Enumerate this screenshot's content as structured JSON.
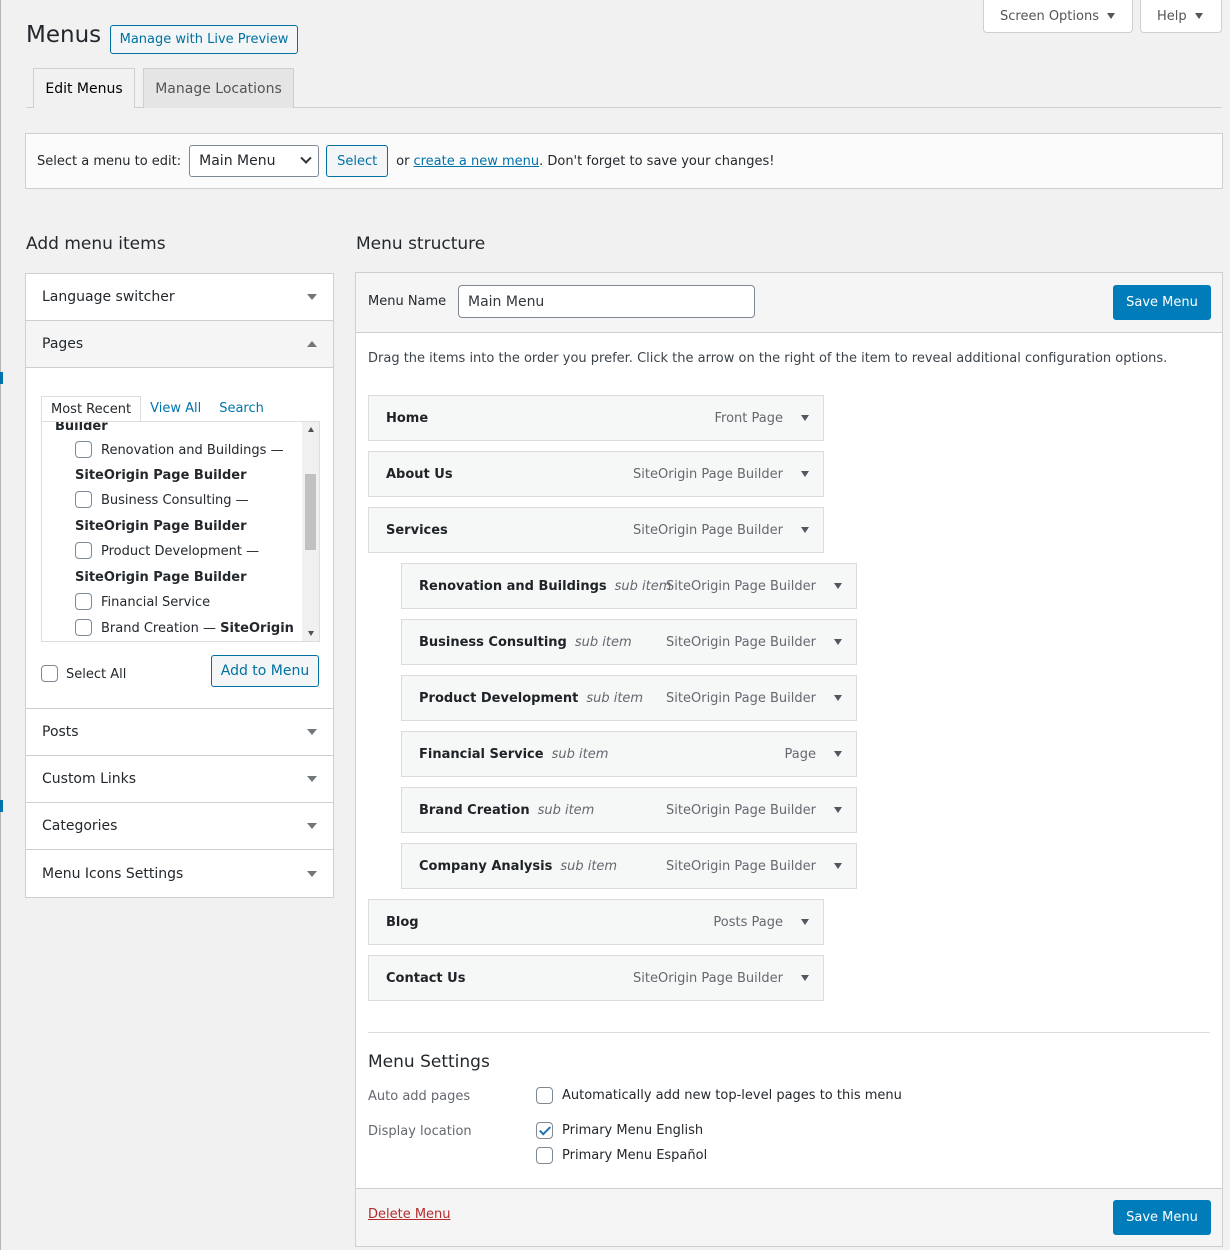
{
  "header": {
    "title": "Menus",
    "live_preview_label": "Manage with Live Preview",
    "screen_options_label": "Screen Options",
    "help_label": "Help"
  },
  "tabs": [
    {
      "label": "Edit Menus",
      "active": true
    },
    {
      "label": "Manage Locations",
      "active": false
    }
  ],
  "select_bar": {
    "prompt": "Select a menu to edit:",
    "selected_menu": "Main Menu",
    "select_button": "Select",
    "or_text": "or",
    "create_link": "create a new menu",
    "reminder": ". Don't forget to save your changes!"
  },
  "add_items": {
    "heading": "Add menu items",
    "sections": [
      "Language switcher",
      "Pages",
      "Posts",
      "Custom Links",
      "Categories",
      "Menu Icons Settings"
    ],
    "page_tabs": [
      "Most Recent",
      "View All",
      "Search"
    ],
    "page_lines": [
      {
        "text": "Builder",
        "kind": "sub-partial"
      },
      {
        "text": "Renovation and Buildings —",
        "kind": "title"
      },
      {
        "text": "SiteOrigin Page Builder",
        "kind": "sub"
      },
      {
        "text": "Business Consulting —",
        "kind": "title"
      },
      {
        "text": "SiteOrigin Page Builder",
        "kind": "sub"
      },
      {
        "text": "Product Development —",
        "kind": "title"
      },
      {
        "text": "SiteOrigin Page Builder",
        "kind": "sub"
      },
      {
        "text": "Financial Service",
        "kind": "title"
      },
      {
        "text": "Brand Creation — ",
        "kind": "title",
        "bold_suffix": "SiteOrigin"
      }
    ],
    "select_all_label": "Select All",
    "add_button": "Add to Menu"
  },
  "structure": {
    "heading": "Menu structure",
    "menu_name_label": "Menu Name",
    "menu_name_value": "Main Menu",
    "save_label": "Save Menu",
    "instructions": "Drag the items into the order you prefer. Click the arrow on the right of the item to reveal additional configuration options.",
    "items": [
      {
        "title": "Home",
        "type": "Front Page",
        "sub": ""
      },
      {
        "title": "About Us",
        "type": "SiteOrigin Page Builder",
        "sub": ""
      },
      {
        "title": "Services",
        "type": "SiteOrigin Page Builder",
        "sub": ""
      },
      {
        "title": "Renovation and Buildings",
        "type": "SiteOrigin Page Builder",
        "sub": "sub item"
      },
      {
        "title": "Business Consulting",
        "type": "SiteOrigin Page Builder",
        "sub": "sub item"
      },
      {
        "title": "Product Development",
        "type": "SiteOrigin Page Builder",
        "sub": "sub item"
      },
      {
        "title": "Financial Service",
        "type": "Page",
        "sub": "sub item"
      },
      {
        "title": "Brand Creation",
        "type": "SiteOrigin Page Builder",
        "sub": "sub item"
      },
      {
        "title": "Company Analysis",
        "type": "SiteOrigin Page Builder",
        "sub": "sub item"
      },
      {
        "title": "Blog",
        "type": "Posts Page",
        "sub": ""
      },
      {
        "title": "Contact Us",
        "type": "SiteOrigin Page Builder",
        "sub": ""
      }
    ]
  },
  "settings": {
    "heading": "Menu Settings",
    "auto_add_label": "Auto add pages",
    "auto_add_option": "Automatically add new top-level pages to this menu",
    "display_location_label": "Display location",
    "locations": [
      {
        "label": "Primary Menu English",
        "checked": true
      },
      {
        "label": "Primary Menu Español",
        "checked": false
      }
    ],
    "delete_label": "Delete Menu"
  }
}
